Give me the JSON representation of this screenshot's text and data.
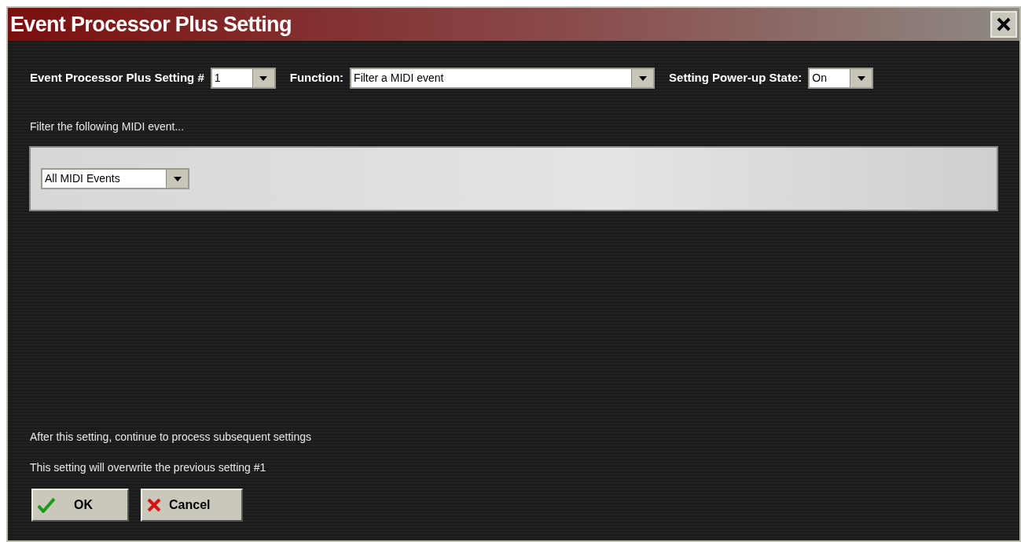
{
  "window": {
    "title": "Event Processor Plus Setting"
  },
  "controls": [
    {
      "label": "Event Processor Plus Setting #",
      "value": "1"
    },
    {
      "label": "Function:",
      "value": "Filter a MIDI event"
    },
    {
      "label": "Setting Power-up State:",
      "value": "On"
    }
  ],
  "filter": {
    "heading": "Filter the following MIDI event...",
    "event": "All MIDI Events"
  },
  "notes": [
    "After this setting, continue to process subsequent settings",
    "This setting will overwrite the previous setting #1"
  ],
  "buttons": [
    {
      "kind": "ok",
      "label": "OK"
    },
    {
      "kind": "cancel",
      "label": "Cancel"
    }
  ]
}
